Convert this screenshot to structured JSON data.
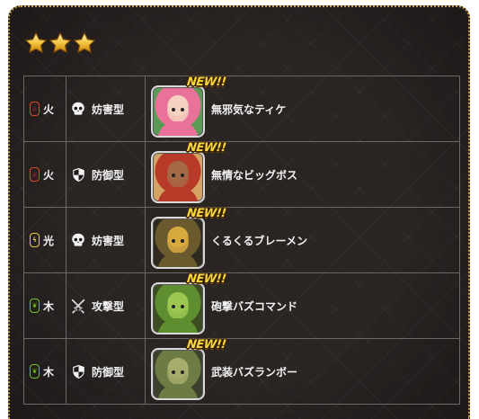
{
  "rarity": {
    "stars": 3
  },
  "badge_text": "NEW!!",
  "colors": {
    "fire": "#e2452d",
    "light": "#e7cd3c",
    "wood": "#6cbf2d",
    "frame": "#c9a24a"
  },
  "units": [
    {
      "element": "火",
      "element_type": "fire",
      "role": "妨害型",
      "role_icon": "skull-icon",
      "name": "無邪気なティケ",
      "portrait_colors": [
        "#e8729a",
        "#f4d2bf",
        "#5a9a54"
      ]
    },
    {
      "element": "火",
      "element_type": "fire",
      "role": "防御型",
      "role_icon": "shield-icon",
      "name": "無情なビッグボス",
      "portrait_colors": [
        "#b83b2a",
        "#a46a46",
        "#d4a262"
      ]
    },
    {
      "element": "光",
      "element_type": "light",
      "role": "妨害型",
      "role_icon": "skull-icon",
      "name": "くるくるブレーメン",
      "portrait_colors": [
        "#6b5a2e",
        "#d7a93f",
        "#2f2a1e"
      ]
    },
    {
      "element": "木",
      "element_type": "wood",
      "role": "攻撃型",
      "role_icon": "swords-icon",
      "name": "砲撃バズコマンド",
      "portrait_colors": [
        "#5f8e31",
        "#9cc851",
        "#3c4d22"
      ]
    },
    {
      "element": "木",
      "element_type": "wood",
      "role": "防御型",
      "role_icon": "shield-icon",
      "name": "武装バズランボー",
      "portrait_colors": [
        "#6d7b45",
        "#a6ad6c",
        "#3c3f2b"
      ]
    }
  ]
}
